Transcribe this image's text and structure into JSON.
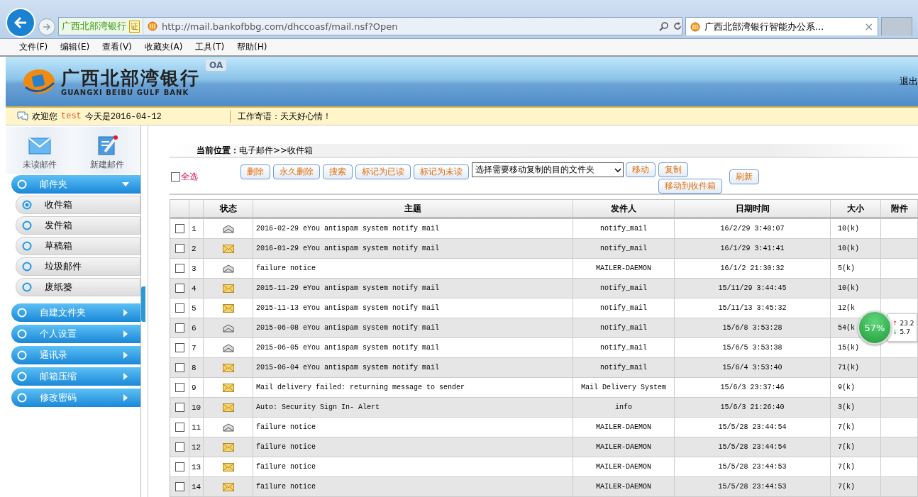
{
  "browser": {
    "cert_label": "广西北部湾银行",
    "cert_badge": "证",
    "url": "http://mail.bankofbbg.com/dhccoasf/mail.nsf?Open",
    "tab": {
      "title": "广西北部湾银行智能办公系...",
      "selected": true,
      "close": "×"
    },
    "menu": [
      "文件(F)",
      "编辑(E)",
      "查看(V)",
      "收藏夹(A)",
      "工具(T)",
      "帮助(H)"
    ]
  },
  "header": {
    "logo_cn": "广西北部湾银行",
    "logo_en": "GUANGXI BEIBU GULF BANK",
    "badge": "OA",
    "logout": "退出"
  },
  "welcome": {
    "greeting": "欢迎您",
    "user": "test",
    "date_text": "今天是2016-04-12",
    "motto": "工作寄语：天天好心情！"
  },
  "sidebar": {
    "shortcuts": [
      {
        "label": "未读邮件",
        "kind": "envelope"
      },
      {
        "label": "新建邮件",
        "kind": "compose"
      }
    ],
    "sections": [
      {
        "label": "邮件夹",
        "expanded": true,
        "children": [
          {
            "label": "收件箱",
            "selected": true
          },
          {
            "label": "发件箱",
            "selected": false
          },
          {
            "label": "草稿箱",
            "selected": false
          },
          {
            "label": "垃圾邮件",
            "selected": false
          },
          {
            "label": "废纸篓",
            "selected": false
          }
        ]
      },
      {
        "label": "自建文件夹",
        "expanded": false
      },
      {
        "label": "个人设置",
        "expanded": false
      },
      {
        "label": "通讯录",
        "expanded": false
      },
      {
        "label": "邮箱压缩",
        "expanded": false
      },
      {
        "label": "修改密码",
        "expanded": false
      }
    ]
  },
  "breadcrumb": {
    "label": "当前位置：",
    "path": "电子邮件>>收件箱"
  },
  "toolbar": {
    "select_all": {
      "label": "全选",
      "checked": false
    },
    "buttons": [
      "删除",
      "永久删除",
      "搜索",
      "标记为已读",
      "标记为未读"
    ],
    "folder_select": "选择需要移动复制的目的文件夹",
    "move": "移动",
    "stacked": [
      "复制",
      "移动到收件箱"
    ],
    "refresh": "刷新"
  },
  "table": {
    "columns": [
      "",
      "",
      "状态",
      "主题",
      "发件人",
      "日期时间",
      "大小",
      "附件"
    ],
    "rows": [
      {
        "checked": false,
        "num": "1",
        "read": true,
        "subject": "2016-02-29 eYou antispam system notify mail",
        "sender": "notify_mail",
        "date": "16/2/29 3:40:07",
        "size": "10(k)"
      },
      {
        "checked": false,
        "num": "2",
        "read": false,
        "subject": "2016-01-29 eYou antispam system notify mail",
        "sender": "notify_mail",
        "date": "16/1/29 3:41:41",
        "size": "10(k)"
      },
      {
        "checked": false,
        "num": "3",
        "read": true,
        "subject": "failure notice",
        "sender": "MAILER-DAEMON",
        "date": "16/1/2 21:30:32",
        "size": "5(k)"
      },
      {
        "checked": false,
        "num": "4",
        "read": false,
        "subject": "2015-11-29 eYou antispam system notify mail",
        "sender": "notify_mail",
        "date": "15/11/29 3:44:45",
        "size": "10(k)"
      },
      {
        "checked": false,
        "num": "5",
        "read": false,
        "subject": "2015-11-13 eYou antispam system notify mail",
        "sender": "notify_mail",
        "date": "15/11/13 3:45:32",
        "size": "12(k"
      },
      {
        "checked": false,
        "num": "6",
        "read": true,
        "subject": "2015-06-08 eYou antispam system notify mail",
        "sender": "notify_mail",
        "date": "15/6/8 3:53:28",
        "size": "54(k"
      },
      {
        "checked": false,
        "num": "7",
        "read": true,
        "subject": "2015-06-05 eYou antispam system notify mail",
        "sender": "notify_mail",
        "date": "15/6/5 3:53:38",
        "size": "15(k)"
      },
      {
        "checked": false,
        "num": "8",
        "read": false,
        "subject": "2015-06-04 eYou antispam system notify mail",
        "sender": "notify_mail",
        "date": "15/6/4 3:53:40",
        "size": "71(k)"
      },
      {
        "checked": false,
        "num": "9",
        "read": false,
        "subject": "Mail delivery failed: returning message to sender",
        "sender": "Mail Delivery System",
        "date": "15/6/3 23:37:46",
        "size": "9(k)"
      },
      {
        "checked": false,
        "num": "10",
        "read": false,
        "subject": "Auto: Security Sign In- Alert",
        "sender": "info",
        "date": "15/6/3 21:26:40",
        "size": "3(k)"
      },
      {
        "checked": false,
        "num": "11",
        "read": true,
        "subject": "failure notice",
        "sender": "MAILER-DAEMON",
        "date": "15/5/28 23:44:54",
        "size": "7(k)"
      },
      {
        "checked": false,
        "num": "12",
        "read": false,
        "subject": "failure notice",
        "sender": "MAILER-DAEMON",
        "date": "15/5/28 23:44:54",
        "size": "7(k)"
      },
      {
        "checked": false,
        "num": "13",
        "read": false,
        "subject": "failure notice",
        "sender": "MAILER-DAEMON",
        "date": "15/5/28 23:44:53",
        "size": "7(k)"
      },
      {
        "checked": false,
        "num": "14",
        "read": false,
        "subject": "failure notice",
        "sender": "MAILER-DAEMON",
        "date": "15/5/28 23:44:53",
        "size": "7(k)"
      }
    ]
  },
  "meter": {
    "percent": "57%",
    "up_arrow": "↑",
    "up": "23.2",
    "down_arrow": "↓",
    "down": "5.7"
  }
}
